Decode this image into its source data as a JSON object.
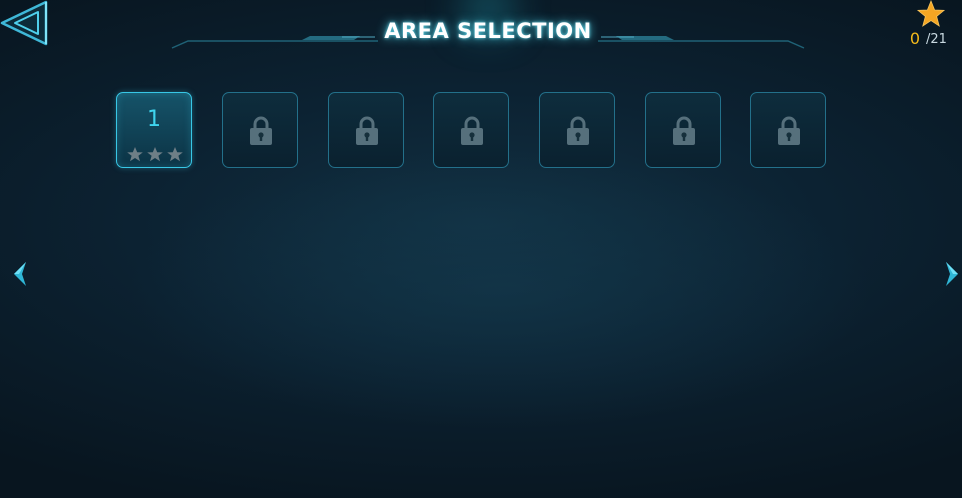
{
  "header": {
    "title": "AREA SELECTION"
  },
  "stars": {
    "earned": "0",
    "total": "/21",
    "icon": "star-icon",
    "color": "#f5a623"
  },
  "levels": [
    {
      "number": "1",
      "locked": false,
      "stars_earned": 0,
      "stars_max": 3
    },
    {
      "locked": true,
      "icon": "lock-icon"
    },
    {
      "locked": true,
      "icon": "lock-icon"
    },
    {
      "locked": true,
      "icon": "lock-icon"
    },
    {
      "locked": true,
      "icon": "lock-icon"
    },
    {
      "locked": true,
      "icon": "lock-icon"
    },
    {
      "locked": true,
      "icon": "lock-icon"
    }
  ],
  "navigation": {
    "back_icon": "back-arrow-icon",
    "prev_icon": "chevron-left-icon",
    "next_icon": "chevron-right-icon"
  },
  "colors": {
    "accent": "#38c7e6",
    "star_gold": "#f3b91b",
    "tile_border": "#23708a"
  }
}
